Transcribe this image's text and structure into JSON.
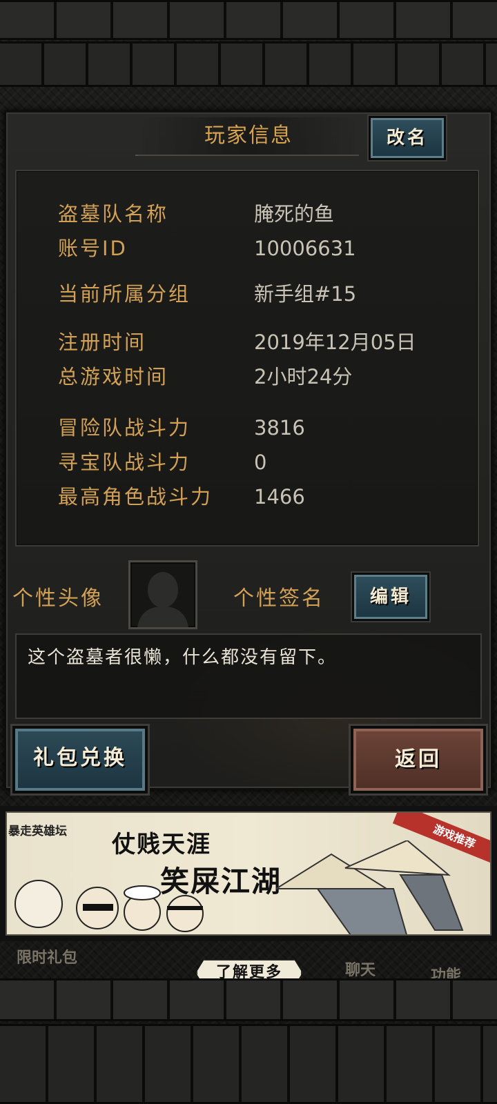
{
  "header": {
    "title": "玩家信息",
    "rename_label": "改名"
  },
  "player_info": {
    "rows": [
      {
        "label": "盗墓队名称",
        "value": "腌死的鱼"
      },
      {
        "label": "账号ID",
        "value": "10006631"
      },
      {
        "label": "当前所属分组",
        "value": "新手组#15"
      },
      {
        "label": "注册时间",
        "value": "2019年12月05日"
      },
      {
        "label": "总游戏时间",
        "value": "2小时24分"
      },
      {
        "label": "冒险队战斗力",
        "value": "3816"
      },
      {
        "label": "寻宝队战斗力",
        "value": "0"
      },
      {
        "label": "最高角色战斗力",
        "value": "1466"
      }
    ]
  },
  "profile": {
    "avatar_label": "个性头像",
    "signature_label": "个性签名",
    "edit_label": "编辑",
    "signature_text": "这个盗墓者很懒，什么都没有留下。"
  },
  "actions": {
    "gift_label": "礼包兑换",
    "back_label": "返回"
  },
  "banner": {
    "brand": "暴走英雄坛",
    "line1": "仗贱天涯",
    "line2": "笑屎江湖",
    "ribbon": "游戏推荐"
  },
  "bottom_nav": {
    "limited_gift": "限时礼包",
    "learn_more": "了解更多",
    "chat": "聊天",
    "function": "功能"
  },
  "colors": {
    "gold": "#d3a155",
    "value_text": "#c8c3b5",
    "teal_button": "#2f4e5c",
    "red_button": "#6d4438"
  }
}
